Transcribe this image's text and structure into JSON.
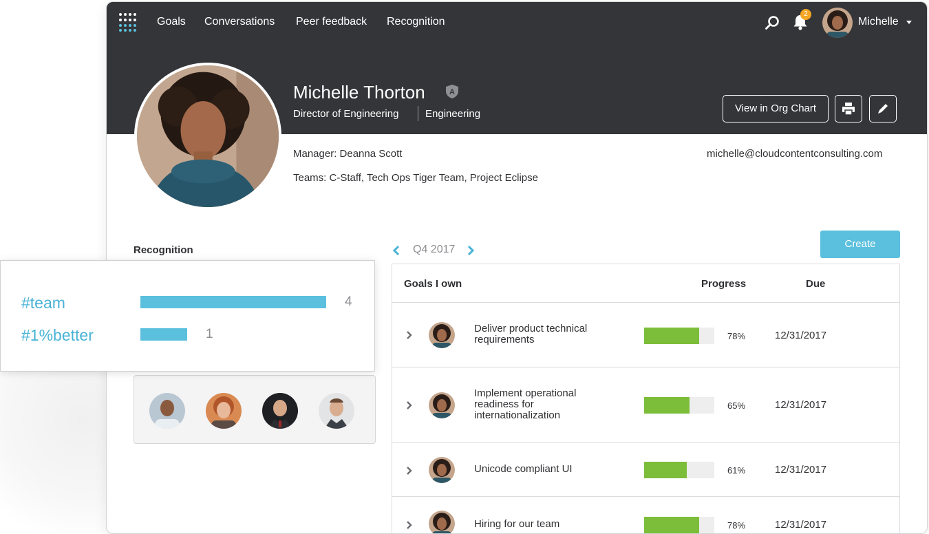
{
  "nav": {
    "items": [
      "Goals",
      "Conversations",
      "Peer feedback",
      "Recognition"
    ],
    "notification_count": "2",
    "user_name": "Michelle"
  },
  "profile": {
    "name": "Michelle Thorton",
    "admin_badge": "A",
    "title": "Director of Engineering",
    "department": "Engineering",
    "manager": "Manager: Deanna Scott",
    "teams": "Teams: C-Staff, Tech Ops Tiger Team, Project Eclipse",
    "email": "michelle@cloudcontentconsulting.com",
    "org_chart_label": "View in Org Chart"
  },
  "recognition": {
    "title": "Recognition",
    "tags": [
      {
        "tag": "#team",
        "count": 4
      },
      {
        "tag": "#1%better",
        "count": 1
      }
    ]
  },
  "goals": {
    "period": "Q4 2017",
    "create_label": "Create",
    "columns": {
      "goal": "Goals I own",
      "progress": "Progress",
      "due": "Due"
    },
    "rows": [
      {
        "title": "Deliver product technical requirements",
        "progress": 78,
        "progress_label": "78%",
        "due": "12/31/2017"
      },
      {
        "title": "Implement operational readiness for internationalization",
        "progress": 65,
        "progress_label": "65%",
        "due": "12/31/2017"
      },
      {
        "title": "Unicode compliant UI",
        "progress": 61,
        "progress_label": "61%",
        "due": "12/31/2017"
      },
      {
        "title": "Hiring for our team",
        "progress": 78,
        "progress_label": "78%",
        "due": "12/31/2017"
      }
    ]
  },
  "colors": {
    "header_bg": "#343538",
    "accent": "#5bc0de",
    "progress_fill": "#7cbd3a",
    "badge": "#f5a623"
  }
}
